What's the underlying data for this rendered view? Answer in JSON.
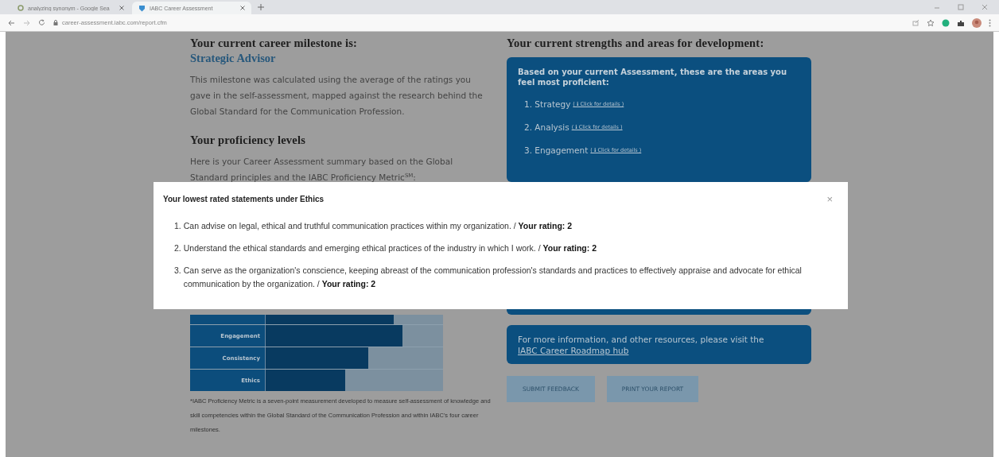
{
  "browser": {
    "tabs": [
      {
        "title": "analyzing synonym - Google Sea",
        "selected": false
      },
      {
        "title": "IABC Career Assessment",
        "selected": true
      }
    ],
    "url": "career-assessment.iabc.com/report.cfm"
  },
  "milestone": {
    "heading": "Your current career milestone is:",
    "value": "Strategic Advisor",
    "description": "This milestone was calculated using the average of the ratings you gave in the self-assessment, mapped against the research behind the Global Standard for the Communication Profession."
  },
  "proficiency": {
    "heading": "Your proficiency levels",
    "intro": "Here is your Career Assessment summary based on the Global Standard principles and the IABC Proficiency Metric$^{SM}$:",
    "bars": [
      {
        "level": 0.72
      },
      {
        "label": "Engagement",
        "level": 0.77
      },
      {
        "label": "Consistency",
        "level": 0.58
      },
      {
        "label": "Ethics",
        "level": 0.45
      }
    ],
    "footnote": "*IABC Proficiency Metric is a seven-point measurement developed to measure self-assessment of knowledge and skill competencies within the Global Standard of the Communication Profession and within IABC's four career milestones."
  },
  "strengths": {
    "heading": "Your current strengths and areas for development:",
    "intro": "Based on your current Assessment, these are the areas you feel most proficient:",
    "items": [
      {
        "label": "1. Strategy",
        "details": "( ℹ Click for details )"
      },
      {
        "label": "2. Analysis",
        "details": "( ℹ Click for details )"
      },
      {
        "label": "3. Engagement",
        "details": "( ℹ Click for details )"
      }
    ]
  },
  "resources": {
    "text": "For more information, and other resources, please visit the",
    "link": "IABC Career Roadmap hub"
  },
  "buttons": [
    "SUBMIT FEEDBACK",
    "PRINT YOUR REPORT"
  ],
  "modal": {
    "title": "Your lowest rated statements under Ethics",
    "close": "×",
    "items": [
      {
        "number": "1.",
        "text": "Can advise on legal, ethical and truthful communication practices within my organization. / **Your rating: 2**"
      },
      {
        "number": "2.",
        "text": "Understand the ethical standards and emerging ethical practices of the industry in which I work. / **Your rating: 2**"
      },
      {
        "number": "3.",
        "text": "Can serve as the organization's conscience, keeping abreast of the communication profession's standards and practices to effectively appraise and advocate for ethical communication by the organization. / **Your rating: 2**"
      }
    ]
  }
}
